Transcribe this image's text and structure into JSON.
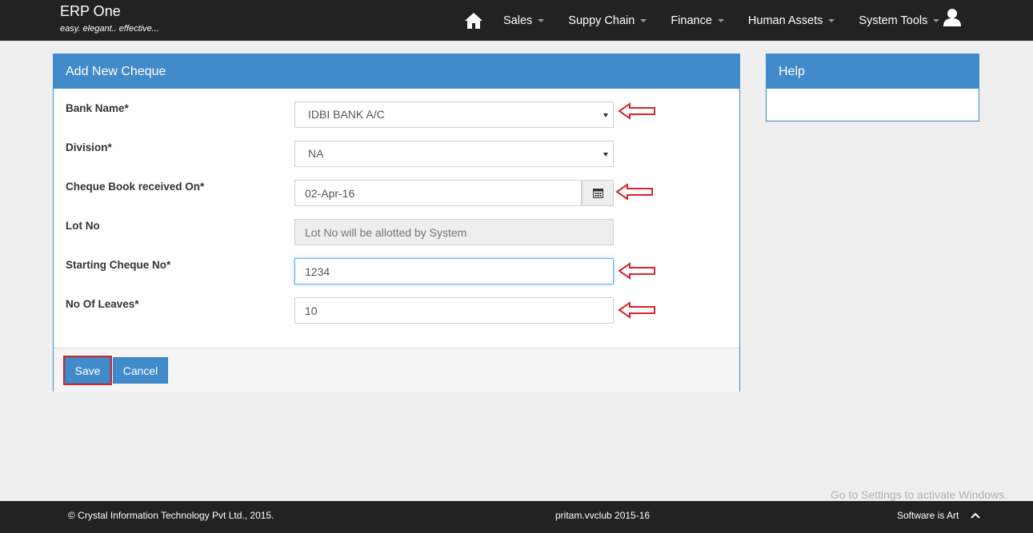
{
  "app": {
    "title": "ERP One",
    "tagline": "easy. elegant.. effective..."
  },
  "nav": {
    "home_icon": "home-icon",
    "items": [
      "Sales",
      "Suppy Chain",
      "Finance",
      "Human Assets",
      "System Tools"
    ],
    "user_icon": "user-icon"
  },
  "form": {
    "title": "Add New Cheque",
    "bank": {
      "label": "Bank Name*",
      "value": "IDBI BANK A/C"
    },
    "division": {
      "label": "Division*",
      "value": "NA"
    },
    "received": {
      "label": "Cheque Book received On*",
      "value": "02-Apr-16"
    },
    "lot": {
      "label": "Lot No",
      "placeholder": "Lot No will be allotted by System"
    },
    "start": {
      "label": "Starting Cheque No*",
      "value": "1234"
    },
    "leaves": {
      "label": "No Of Leaves*",
      "value": "10"
    },
    "save_label": "Save",
    "cancel_label": "Cancel"
  },
  "help": {
    "title": "Help"
  },
  "footer": {
    "copyright": "© Crystal Information Technology Pvt Ltd., 2015.",
    "center": "pritam.vvclub 2015-16",
    "tagline": "Software is Art"
  },
  "watermark": "Go to Settings to activate Windows.",
  "colors": {
    "navbar": "#222222",
    "primary": "#428bca",
    "annotation": "#d9232d"
  }
}
